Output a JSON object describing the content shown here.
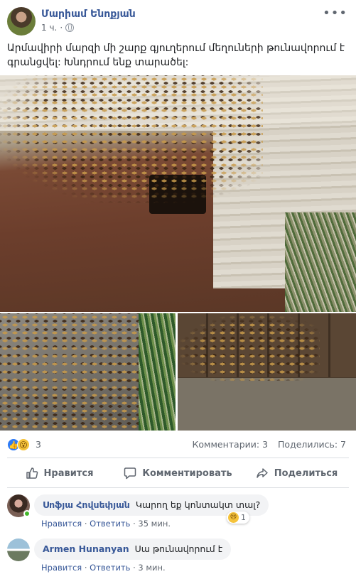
{
  "post": {
    "author": "Մարիամ Ենոքյան",
    "time": "1 ч.",
    "privacy_icon": "globe-icon",
    "more_icon": "ellipsis-icon",
    "text": "Արմավիրի մարզի մի շարք գյուղերում մեղուների թունավորում է գրանցվել: Խնդրում ենք տարածել:"
  },
  "photos": [
    {
      "description_icon": "photo-dead-bees-hive-entrance"
    },
    {
      "description_icon": "photo-dead-bees-ground"
    },
    {
      "description_icon": "photo-dead-bees-wall"
    }
  ],
  "stats": {
    "reaction_icons": [
      "like-icon",
      "wow-icon"
    ],
    "reactions_count": "3",
    "comments": "Комментарии: 3",
    "shares": "Поделились: 7"
  },
  "actions": {
    "like": "Нравится",
    "comment": "Комментировать",
    "share": "Поделиться"
  },
  "comments": [
    {
      "author": "Սոֆյա Հովսեփյան",
      "text": "Կարող եք կոնտակտ տալ?",
      "reaction_count": "1",
      "reaction_icon": "sad-icon",
      "like": "Нравится",
      "sep1": " · ",
      "reply": "Ответить",
      "sep2": " · ",
      "time": "35 мин."
    },
    {
      "author": "Armen Hunanyan",
      "text": "Սա թունավորում է",
      "like": "Нравится",
      "sep1": " · ",
      "reply": "Ответить",
      "sep2": " · ",
      "time": "3 мин."
    }
  ],
  "colors": {
    "link": "#385898",
    "accent": "#2e7bf6",
    "online": "#42b72a"
  }
}
